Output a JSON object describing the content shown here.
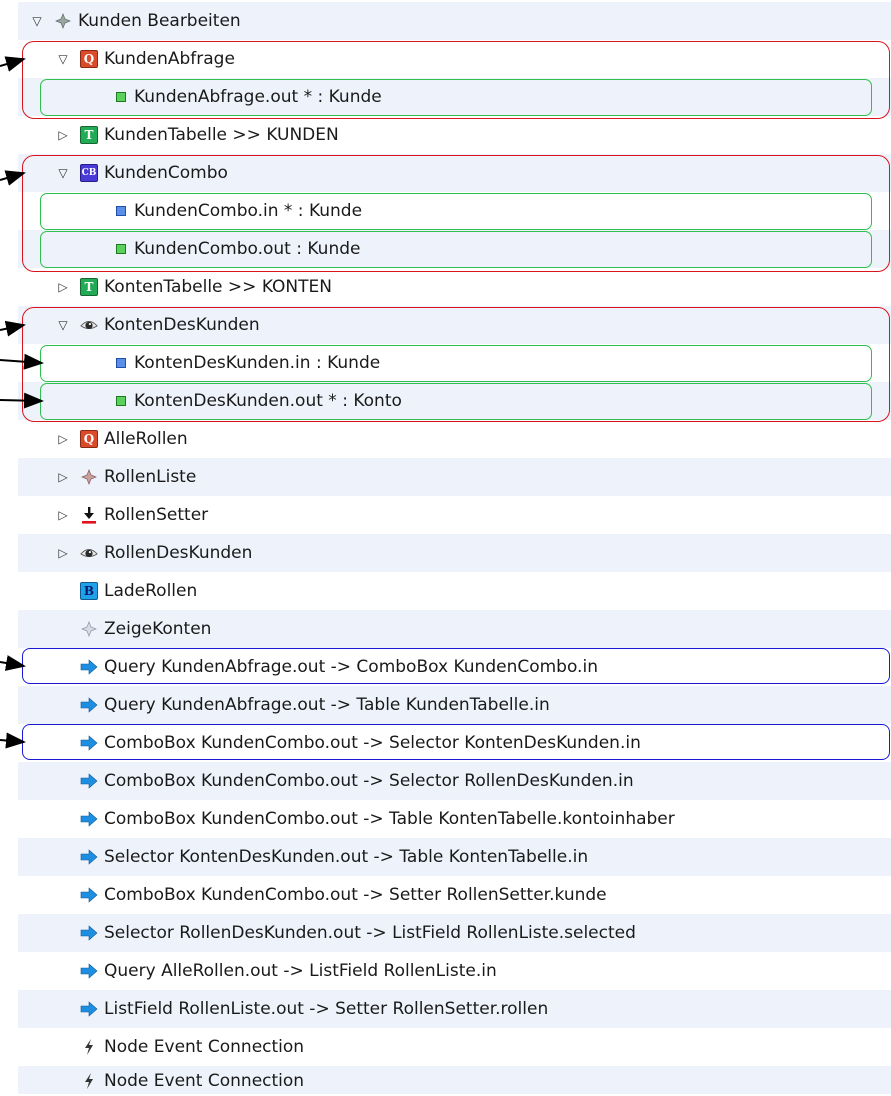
{
  "tree": {
    "rows": [
      {
        "label": "Kunden Bearbeiten",
        "icon": "star-icon",
        "expand": "expanded"
      },
      {
        "label": "KundenAbfrage",
        "icon": "query-icon",
        "badge": "Q",
        "expand": "expanded"
      },
      {
        "label": "KundenAbfrage.out * : Kunde",
        "icon": "output-port-icon"
      },
      {
        "label": "KundenTabelle >> KUNDEN",
        "icon": "table-icon",
        "badge": "T",
        "expand": "collapsed"
      },
      {
        "label": "KundenCombo",
        "icon": "combobox-icon",
        "badge": "CB",
        "expand": "expanded"
      },
      {
        "label": "KundenCombo.in * : Kunde",
        "icon": "input-port-icon"
      },
      {
        "label": "KundenCombo.out : Kunde",
        "icon": "output-port-icon"
      },
      {
        "label": "KontenTabelle >> KONTEN",
        "icon": "table-icon",
        "badge": "T",
        "expand": "collapsed"
      },
      {
        "label": "KontenDesKunden",
        "icon": "eye-icon",
        "expand": "expanded"
      },
      {
        "label": "KontenDesKunden.in : Kunde",
        "icon": "input-port-icon"
      },
      {
        "label": "KontenDesKunden.out * : Konto",
        "icon": "output-port-icon"
      },
      {
        "label": "AlleRollen",
        "icon": "query-icon",
        "badge": "Q",
        "expand": "collapsed"
      },
      {
        "label": "RollenListe",
        "icon": "star-icon",
        "expand": "collapsed"
      },
      {
        "label": "RollenSetter",
        "icon": "setter-icon",
        "expand": "collapsed"
      },
      {
        "label": "RollenDesKunden",
        "icon": "eye-icon",
        "expand": "collapsed"
      },
      {
        "label": "LadeRollen",
        "icon": "button-icon",
        "badge": "B"
      },
      {
        "label": "ZeigeKonten",
        "icon": "star-outline-icon"
      },
      {
        "label": "Query KundenAbfrage.out -> ComboBox KundenCombo.in",
        "icon": "connection-arrow-icon"
      },
      {
        "label": "Query KundenAbfrage.out -> Table KundenTabelle.in",
        "icon": "connection-arrow-icon"
      },
      {
        "label": "ComboBox KundenCombo.out -> Selector KontenDesKunden.in",
        "icon": "connection-arrow-icon"
      },
      {
        "label": "ComboBox KundenCombo.out -> Selector RollenDesKunden.in",
        "icon": "connection-arrow-icon"
      },
      {
        "label": "ComboBox KundenCombo.out -> Table KontenTabelle.kontoinhaber",
        "icon": "connection-arrow-icon"
      },
      {
        "label": "Selector KontenDesKunden.out -> Table KontenTabelle.in",
        "icon": "connection-arrow-icon"
      },
      {
        "label": "ComboBox KundenCombo.out -> Setter RollenSetter.kunde",
        "icon": "connection-arrow-icon"
      },
      {
        "label": "Selector RollenDesKunden.out -> ListField RollenListe.selected",
        "icon": "connection-arrow-icon"
      },
      {
        "label": "Query AlleRollen.out -> ListField RollenListe.in",
        "icon": "connection-arrow-icon"
      },
      {
        "label": "ListField RollenListe.out -> Setter RollenSetter.rollen",
        "icon": "connection-arrow-icon"
      },
      {
        "label": "Node Event Connection",
        "icon": "lightning-icon"
      },
      {
        "label": "Node Event Connection",
        "icon": "lightning-icon"
      }
    ]
  },
  "colors": {
    "row_alt": "#eef3fb",
    "red_frame": "#d9141e",
    "green_frame": "#2fbf4f",
    "blue_frame": "#1a1ad6",
    "connection_arrow": "#1e8fe0"
  }
}
